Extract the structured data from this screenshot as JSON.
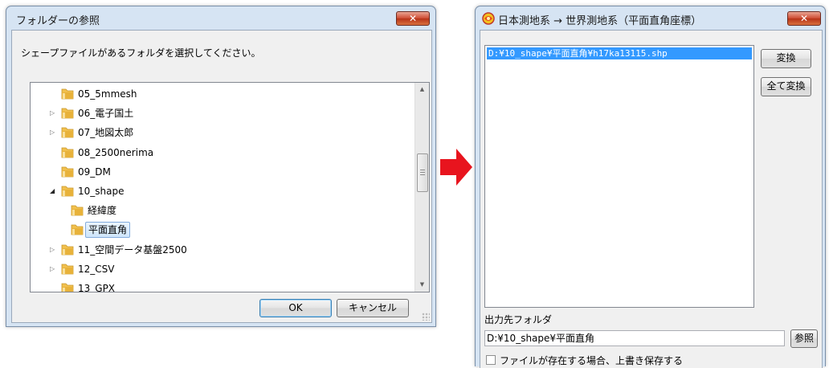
{
  "browse_dialog": {
    "title": "フォルダーの参照",
    "close_label": "✕",
    "prompt": "シェープファイルがあるフォルダを選択してください。",
    "tree": [
      {
        "label": "05_5mmesh",
        "expander": ""
      },
      {
        "label": "06_電子国土",
        "expander": "collapsed"
      },
      {
        "label": "07_地図太郎",
        "expander": "collapsed"
      },
      {
        "label": "08_2500nerima",
        "expander": ""
      },
      {
        "label": "09_DM",
        "expander": ""
      },
      {
        "label": "10_shape",
        "expander": "expanded"
      },
      {
        "label": "経緯度",
        "expander": ""
      },
      {
        "label": "平面直角",
        "expander": "",
        "selected": true
      },
      {
        "label": "11_空間データ基盤2500",
        "expander": "collapsed"
      },
      {
        "label": "12_CSV",
        "expander": "collapsed"
      },
      {
        "label": "13_GPX",
        "expander": ""
      }
    ],
    "ok_label": "OK",
    "cancel_label": "キャンセル"
  },
  "converter": {
    "title": "日本測地系 → 世界測地系（平面直角座標）",
    "close_label": "✕",
    "file_list": [
      "D:¥10_shape¥平面直角¥h17ka13115.shp"
    ],
    "convert_label": "変換",
    "convert_all_label": "全て変換",
    "output_folder_label": "出力先フォルダ",
    "output_folder_value": "D:¥10_shape¥平面直角",
    "browse_label": "参照",
    "overwrite_label": "ファイルが存在する場合、上書き保存する",
    "overwrite_checked": false
  },
  "colors": {
    "arrow": "#e8141e",
    "selection": "#3399ff",
    "folder": "#e8b23a"
  }
}
